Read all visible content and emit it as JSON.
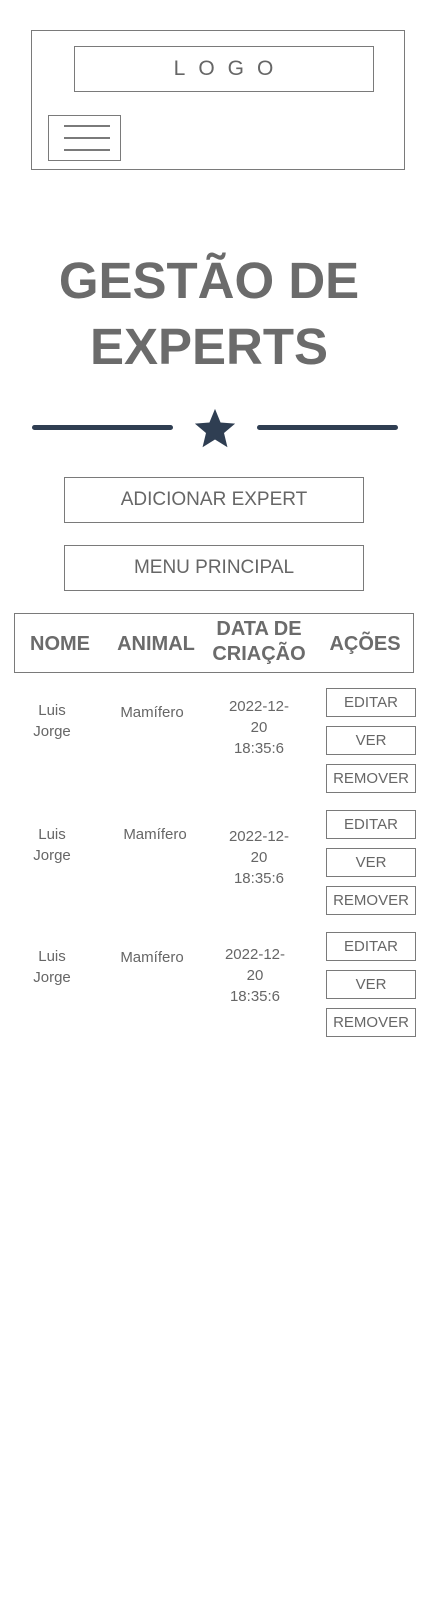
{
  "header": {
    "logo_text": "LOGO"
  },
  "page_title_line1": "GESTÃO DE",
  "page_title_line2": "EXPERTS",
  "actions": {
    "add_expert": "ADICIONAR EXPERT",
    "main_menu": "MENU PRINCIPAL"
  },
  "table": {
    "headers": {
      "name": "NOME",
      "animal": "ANIMAL",
      "date_line1": "DATA DE",
      "date_line2": "CRIAÇÃO",
      "actions": "AÇÕES"
    },
    "rows": [
      {
        "name_line1": "Luis",
        "name_line2": "Jorge",
        "animal": "Mamífero",
        "date_line1": "2022-12-",
        "date_line2": "20",
        "date_line3": "18:35:6"
      },
      {
        "name_line1": "Luis",
        "name_line2": "Jorge",
        "animal": "Mamífero",
        "date_line1": "2022-12-",
        "date_line2": "20",
        "date_line3": "18:35:6"
      },
      {
        "name_line1": "Luis",
        "name_line2": "Jorge",
        "animal": "Mamífero",
        "date_line1": "2022-12-",
        "date_line2": "20",
        "date_line3": "18:35:6"
      }
    ],
    "row_buttons": {
      "edit": "EDITAR",
      "view": "VER",
      "remove": "REMOVER"
    }
  },
  "colors": {
    "accent": "#2f3e52",
    "border": "#7a7a7a",
    "text": "#666666"
  },
  "icons": {
    "divider_icon": "star-icon",
    "menu_icon": "hamburger-menu-icon"
  }
}
